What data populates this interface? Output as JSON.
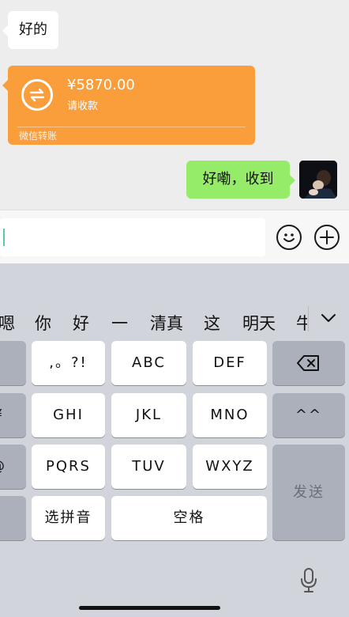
{
  "chat": {
    "incoming_text": "好的",
    "transfer": {
      "amount": "¥5870.00",
      "subtitle": "请收款",
      "footer": "微信转账"
    },
    "outgoing_text": "好嘞，收到"
  },
  "input": {
    "value": ""
  },
  "candidates": [
    "嗯",
    "你",
    "好",
    "一",
    "清真",
    "这",
    "明天",
    "牛"
  ],
  "keys": {
    "row1": [
      ",。?!",
      "ABC",
      "DEF"
    ],
    "row2": [
      "GHI",
      "JKL",
      "MNO"
    ],
    "row3": [
      "PQRS",
      "TUV",
      "WXYZ"
    ],
    "left_row2": "¥",
    "left_row3": "@",
    "emoticon": "^^",
    "pinyin": "选拼音",
    "space": "空格",
    "send": "发送"
  }
}
